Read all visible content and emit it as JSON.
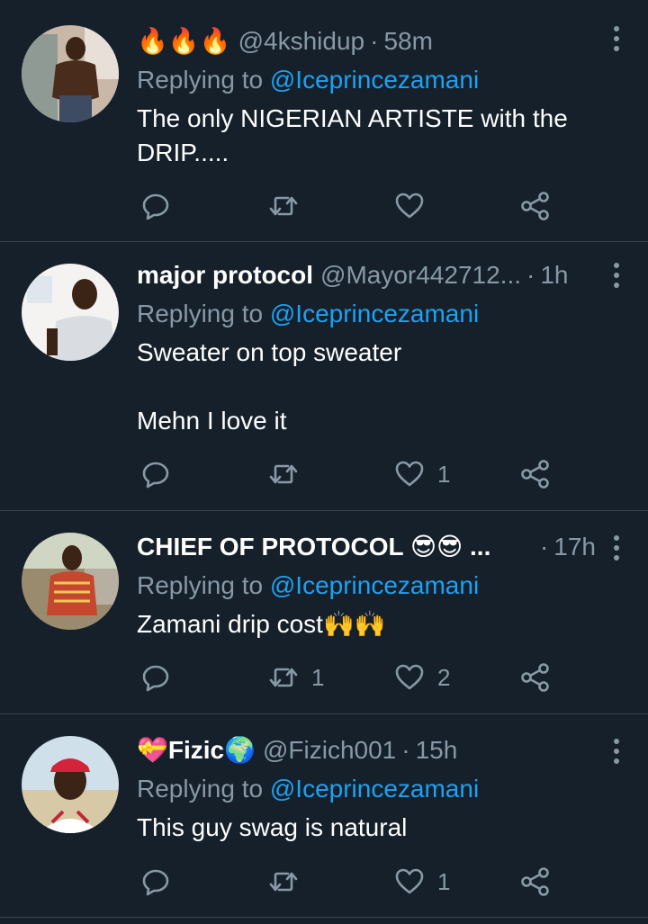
{
  "tweets": [
    {
      "name": "🔥🔥🔥",
      "handle": "@4kshidup",
      "sep": "·",
      "time": "58m",
      "replying_prefix": "Replying to ",
      "replying_to": "@Iceprincezamani",
      "text": "The only NIGERIAN ARTISTE with the DRIP.....",
      "retweets": "",
      "likes": ""
    },
    {
      "name": "major protocol",
      "handle": "@Mayor442712...",
      "sep": "·",
      "time": "1h",
      "replying_prefix": "Replying to ",
      "replying_to": "@Iceprincezamani",
      "text": "Sweater on top sweater\n\nMehn I love it",
      "retweets": "",
      "likes": "1"
    },
    {
      "name": "CHIEF OF PROTOCOL 😎😎 ...",
      "handle": "",
      "sep": "·",
      "time": "17h",
      "replying_prefix": "Replying to ",
      "replying_to": "@Iceprincezamani",
      "text": "Zamani drip cost🙌🙌",
      "retweets": "1",
      "likes": "2"
    },
    {
      "name": "💝Fizic🌍",
      "handle": "@Fizich001",
      "sep": "·",
      "time": "15h",
      "replying_prefix": "Replying to ",
      "replying_to": "@Iceprincezamani",
      "text": "This guy swag is natural",
      "retweets": "",
      "likes": "1"
    }
  ],
  "icons": {
    "reply": "reply-icon",
    "retweet": "retweet-icon",
    "like": "heart-icon",
    "share": "share-icon",
    "more": "more-vertical-icon"
  },
  "colors": {
    "background": "#15202b",
    "secondary_text": "#8899a6",
    "link": "#1da1f2",
    "divider": "#38444d"
  }
}
